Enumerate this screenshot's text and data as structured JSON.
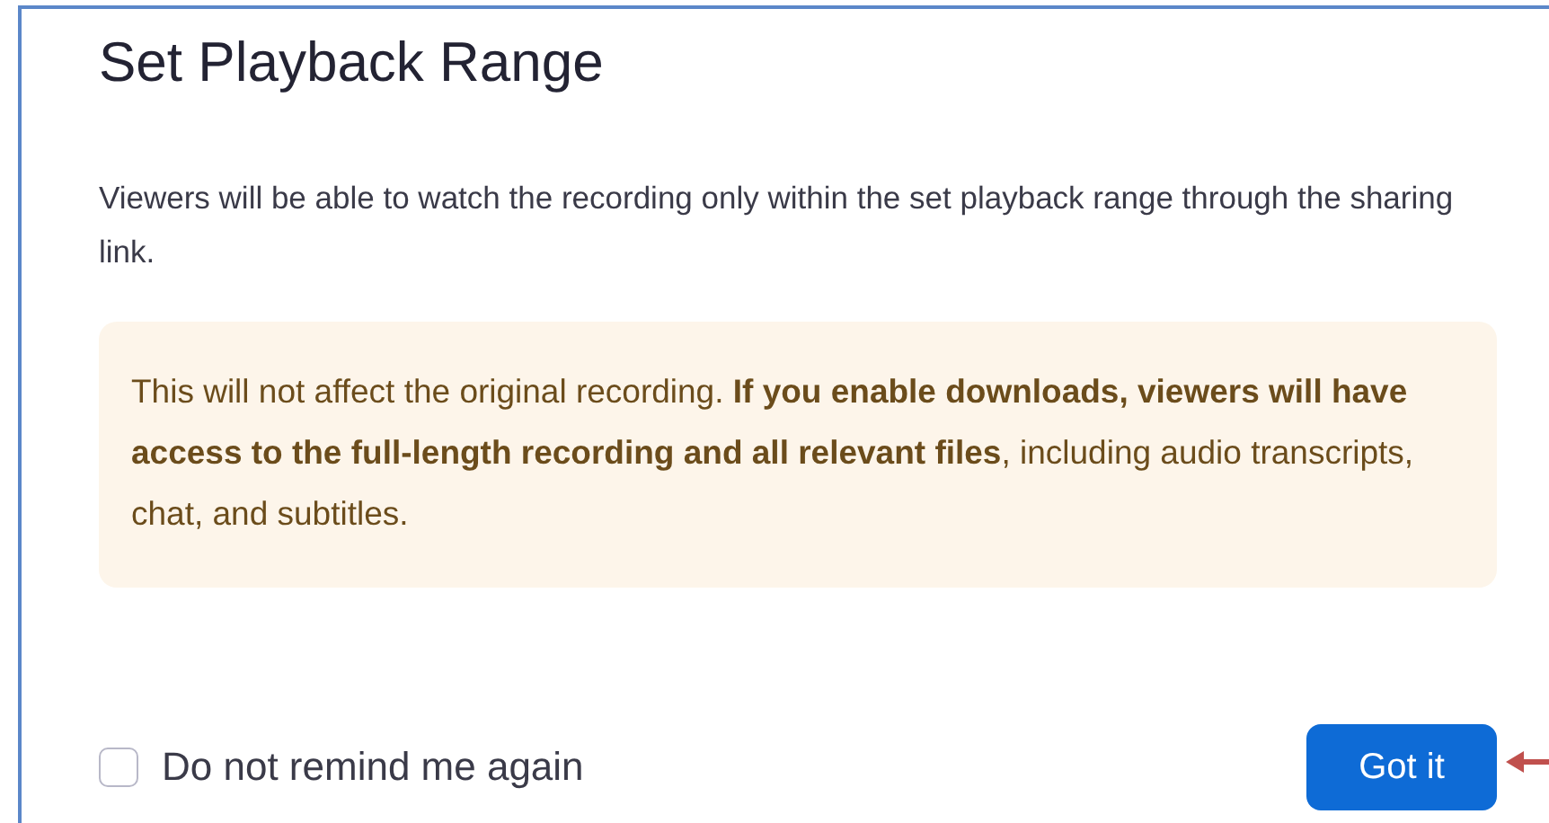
{
  "dialog": {
    "title": "Set Playback Range",
    "description": "Viewers will be able to watch the recording only within the set playback range through the sharing link.",
    "notice": "This will not affect the original recording. **If you enable downloads, viewers will have access to the full-length recording and all relevant files**, including audio transcripts, chat, and subtitles.",
    "reminder": {
      "label": "Do not remind me again",
      "checked": false
    },
    "button": "Got it"
  }
}
